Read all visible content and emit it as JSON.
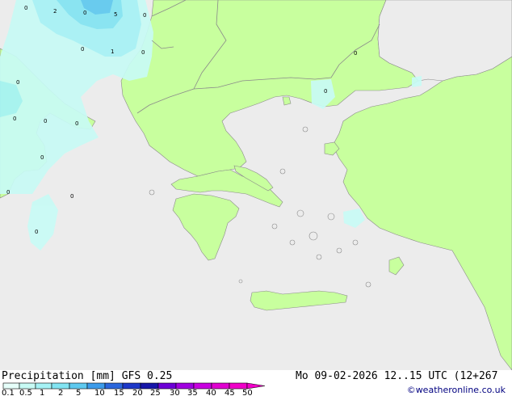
{
  "footer": {
    "title": "Precipitation [mm]",
    "model": "GFS 0.25",
    "datetime": "Mo 09-02-2026 12..15 UTC (12+267",
    "credit": "©weatheronline.co.uk"
  },
  "legend": {
    "ticks": [
      "0.1",
      "0.5",
      "1",
      "2",
      "5",
      "10",
      "15",
      "20",
      "25",
      "30",
      "35",
      "40",
      "45",
      "50"
    ],
    "colors": [
      "#e6fffa",
      "#c8fbf5",
      "#a6f2f5",
      "#82e4f2",
      "#5ec9ef",
      "#3c9bea",
      "#2b66dc",
      "#1c38c8",
      "#1616a8",
      "#6d00d6",
      "#a000e0",
      "#c800e0",
      "#e000d0",
      "#f000c8"
    ]
  },
  "map": {
    "sea_color": "#ececec",
    "land_color": "#c8ff9e",
    "border_color": "#8a8a8a",
    "precip_colors": {
      "light": "#c8fbf5",
      "medium": "#a6f2f5",
      "strong": "#82e4f2",
      "heavy": "#5ec9ef"
    },
    "value_labels": [
      "0",
      "2",
      "0",
      "5",
      "0",
      "0",
      "1",
      "0",
      "0",
      "0",
      "0",
      "0",
      "0",
      "0",
      "0",
      "0",
      "0",
      "0"
    ]
  }
}
